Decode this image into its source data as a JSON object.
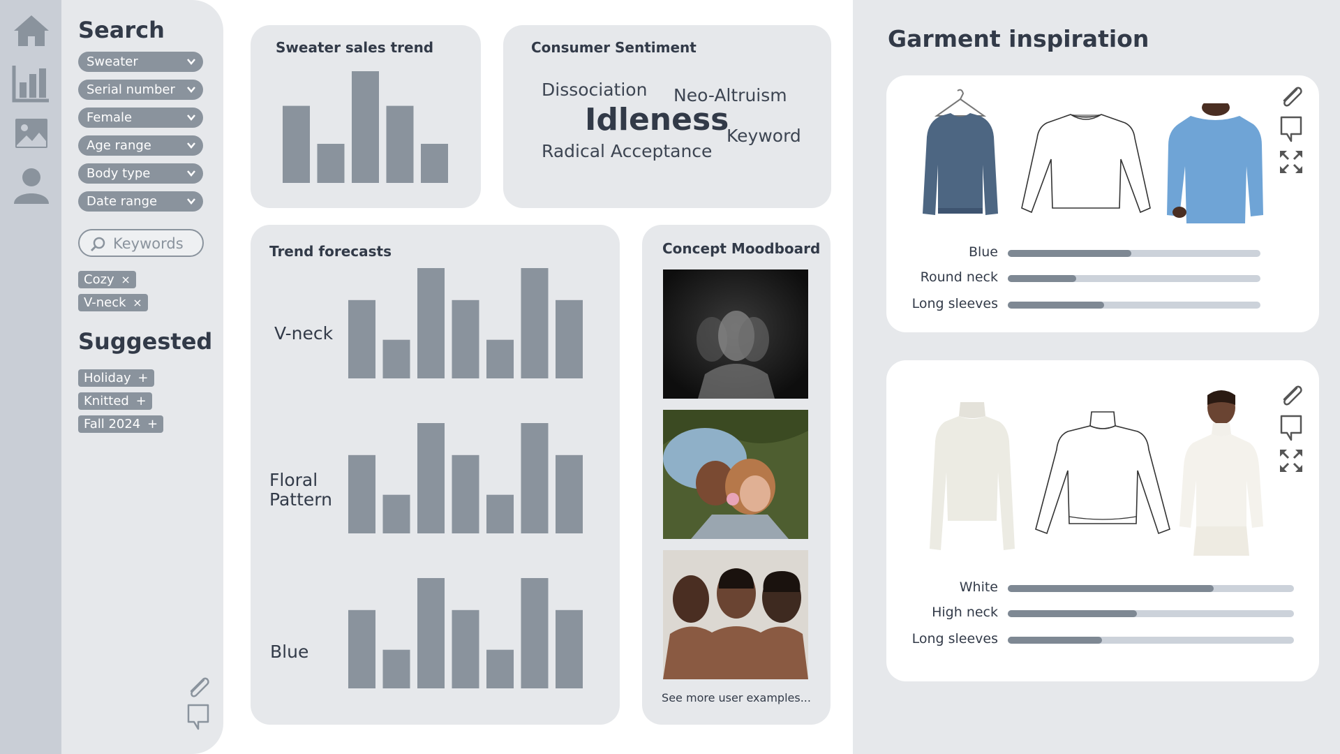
{
  "nav": {
    "icons": [
      "home-icon",
      "bar-chart-icon",
      "image-icon",
      "user-icon"
    ]
  },
  "sidebar": {
    "search_title": "Search",
    "filters": [
      {
        "label": "Sweater"
      },
      {
        "label": "Serial number"
      },
      {
        "label": "Female"
      },
      {
        "label": "Age range"
      },
      {
        "label": "Body type"
      },
      {
        "label": "Date range"
      }
    ],
    "keywords_placeholder": "Keywords",
    "active_tags": [
      {
        "label": "Cozy",
        "symbol": "×"
      },
      {
        "label": "V-neck",
        "symbol": "×"
      }
    ],
    "suggested_title": "Suggested",
    "suggested_tags": [
      {
        "label": "Holiday",
        "symbol": "+"
      },
      {
        "label": "Knitted",
        "symbol": "+"
      },
      {
        "label": "Fall 2024",
        "symbol": "+"
      }
    ]
  },
  "sales_trend": {
    "title": "Sweater sales trend",
    "chart_data": {
      "type": "bar",
      "values": [
        0.69,
        0.35,
        1.0,
        0.69,
        0.35
      ],
      "bar_color": "#8a939d"
    }
  },
  "sentiment": {
    "title": "Consumer Sentiment",
    "words": [
      {
        "text": "Dissociation"
      },
      {
        "text": "Neo-Altruism"
      },
      {
        "text": "Idleness"
      },
      {
        "text": "Keyword"
      },
      {
        "text": "Radical Acceptance"
      }
    ]
  },
  "forecasts": {
    "title": "Trend forecasts",
    "rows": [
      {
        "label": "V-neck",
        "values": [
          0.71,
          0.35,
          1.0,
          0.71,
          0.35,
          1.0,
          0.71
        ]
      },
      {
        "label": "Floral Pattern",
        "values": [
          0.71,
          0.35,
          1.0,
          0.71,
          0.35,
          1.0,
          0.71
        ]
      },
      {
        "label": "Blue",
        "values": [
          0.71,
          0.35,
          1.0,
          0.71,
          0.35,
          1.0,
          0.71
        ]
      }
    ],
    "bar_color": "#8a939d"
  },
  "moodboard": {
    "title": "Concept Moodboard",
    "images": [
      "blurred-portrait",
      "couple-on-grass",
      "group-portrait"
    ],
    "see_more": "See more user examples..."
  },
  "garments": {
    "title": "Garment inspiration",
    "cards": [
      {
        "images": [
          "navy-sweater-on-hanger",
          "round-neck-sketch",
          "model-blue-sweater"
        ],
        "attributes": [
          {
            "label": "Blue",
            "value": 0.49
          },
          {
            "label": "Round neck",
            "value": 0.27
          },
          {
            "label": "Long sleeves",
            "value": 0.38
          }
        ]
      },
      {
        "images": [
          "cream-turtleneck",
          "high-neck-sketch",
          "model-white-turtleneck"
        ],
        "attributes": [
          {
            "label": "White",
            "value": 0.72
          },
          {
            "label": "High neck",
            "value": 0.45
          },
          {
            "label": "Long sleeves",
            "value": 0.33
          }
        ]
      }
    ],
    "tool_icons": [
      "paperclip-icon",
      "comment-icon",
      "expand-icon"
    ]
  },
  "colors": {
    "rail": "#c9ced6",
    "panel": "#e6e8eb",
    "accent": "#8a939d",
    "text": "#323a48"
  }
}
